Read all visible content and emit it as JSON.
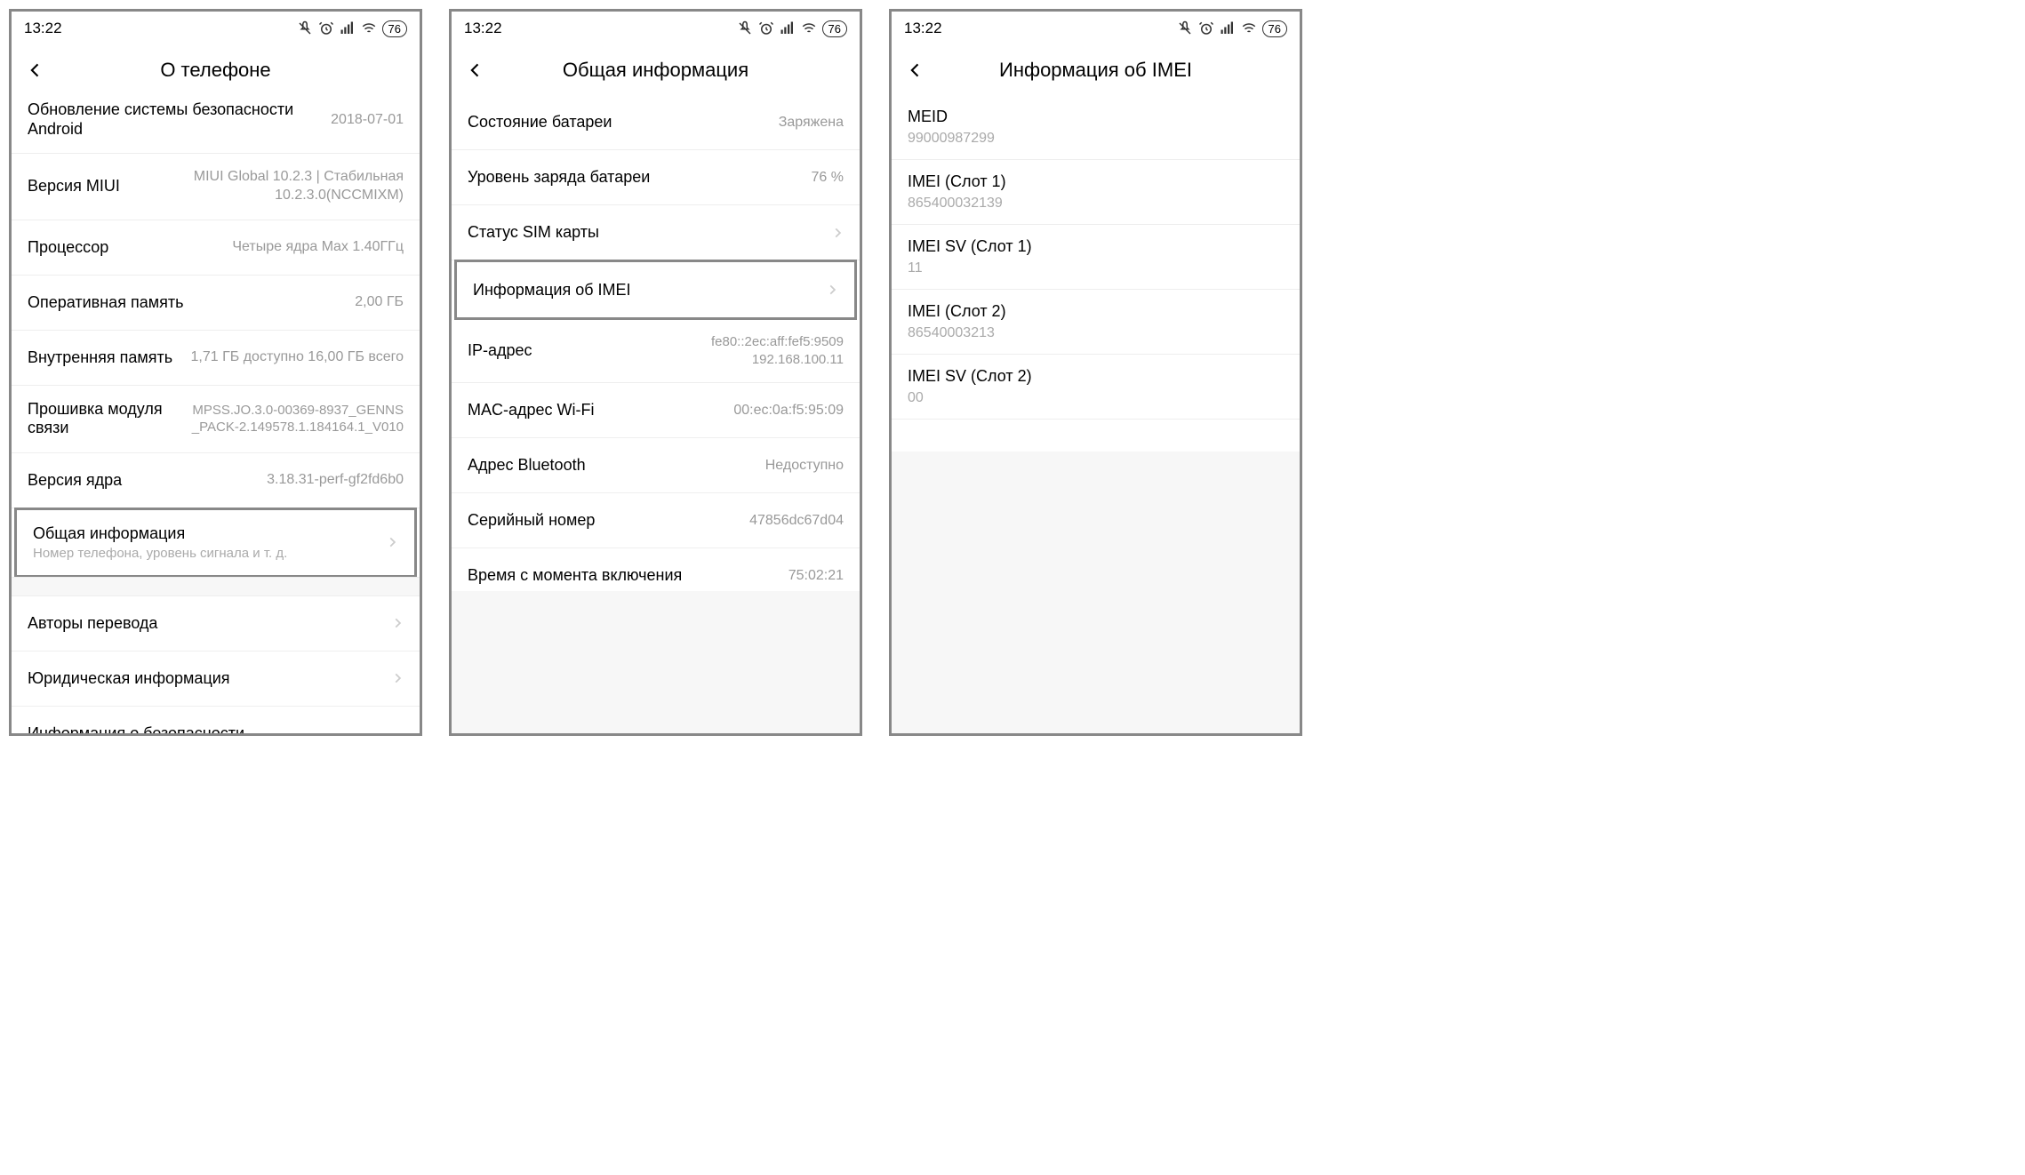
{
  "statusbar": {
    "time": "13:22",
    "battery_pct": "76"
  },
  "screens": {
    "about": {
      "title": "О телефоне",
      "rows": {
        "sec_update_label": "Обновление системы безопасности Android",
        "sec_update_val": "2018-07-01",
        "miui_label": "Версия MIUI",
        "miui_val": "MIUI Global 10.2.3 | Стабильная 10.2.3.0(NCCMIXM)",
        "cpu_label": "Процессор",
        "cpu_val": "Четыре ядра Max 1.40ГГц",
        "ram_label": "Оперативная память",
        "ram_val": "2,00 ГБ",
        "storage_label": "Внутренняя память",
        "storage_val": "1,71 ГБ доступно 16,00 ГБ всего",
        "baseband_label": "Прошивка модуля связи",
        "baseband_val": "MPSS.JO.3.0-00369-8937_GENNS_PACK-2.149578.1.184164.1_V010",
        "kernel_label": "Версия ядра",
        "kernel_val": "3.18.31-perf-gf2fd6b0",
        "status_label": "Общая информация",
        "status_sub": "Номер телефона, уровень сигнала и т. д.",
        "credits_label": "Авторы перевода",
        "legal_label": "Юридическая информация",
        "safety_label": "Информация о безопасности"
      }
    },
    "status": {
      "title": "Общая информация",
      "rows": {
        "batt_state_label": "Состояние батареи",
        "batt_state_val": "Заряжена",
        "batt_level_label": "Уровень заряда батареи",
        "batt_level_val": "76 %",
        "sim_label": "Статус SIM карты",
        "imei_label": "Информация об IMEI",
        "ip_label": "IP-адрес",
        "ip_val": "fe80::2ec:aff:fef5:9509 192.168.100.11",
        "mac_label": "MAC-адрес Wi-Fi",
        "mac_val": "00:ec:0a:f5:95:09",
        "bt_label": "Адрес Bluetooth",
        "bt_val": "Недоступно",
        "serial_label": "Серийный номер",
        "serial_val": "47856dc67d04",
        "uptime_label": "Время с момента включения",
        "uptime_val": "75:02:21"
      }
    },
    "imei": {
      "title": "Информация об IMEI",
      "rows": {
        "meid_label": "MEID",
        "meid_val": "99000987299",
        "imei1_label": "IMEI (Слот 1)",
        "imei1_val": "865400032139",
        "imeisv1_label": "IMEI SV (Слот 1)",
        "imeisv1_val": "11",
        "imei2_label": "IMEI (Слот 2)",
        "imei2_val": "86540003213",
        "imeisv2_label": "IMEI SV (Слот 2)",
        "imeisv2_val": "00"
      }
    }
  }
}
